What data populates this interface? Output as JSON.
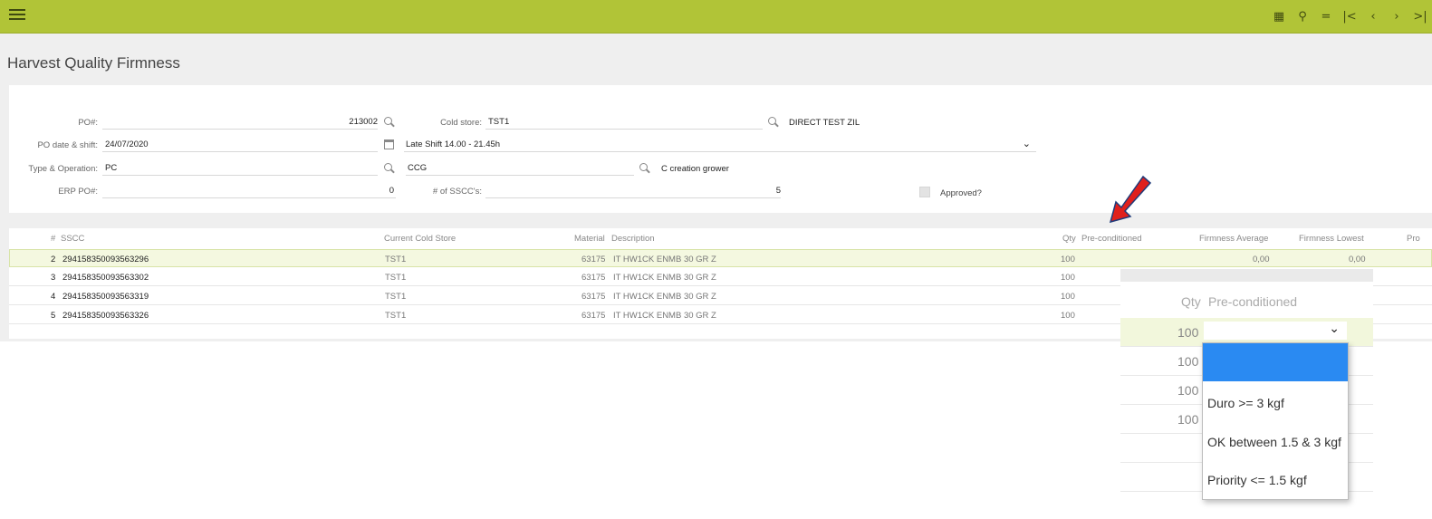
{
  "toolbar": {
    "menu_icon": "hamburger-menu-icon",
    "icons": [
      "calendar-icon",
      "search-icon",
      "minus-icon",
      "first-page-icon",
      "previous-icon",
      "next-icon",
      "last-page-icon"
    ],
    "glyphs": [
      "▦",
      "⚲",
      "=",
      "|<",
      "‹",
      "›",
      ">|"
    ],
    "accent_color": "#b1c437"
  },
  "page": {
    "title": "Harvest Quality Firmness"
  },
  "form": {
    "po_label": "PO#:",
    "po_value": "213002",
    "cold_store_label": "Cold store:",
    "cold_store_value": "TST1",
    "cold_store_desc": "DIRECT TEST ZIL",
    "po_date_label": "PO date & shift:",
    "po_date_value": "24/07/2020",
    "shift_value": "Late Shift 14.00 - 21.45h",
    "type_op_label": "Type & Operation:",
    "type_value": "PC",
    "operation_value": "CCG",
    "operation_desc": "C creation grower",
    "erp_po_label": "ERP PO#:",
    "erp_po_value": "0",
    "sscc_count_label": "# of SSCC's:",
    "sscc_count_value": "5",
    "approved_label": "Approved?"
  },
  "grid": {
    "headers": {
      "num": "#",
      "sscc": "SSCC",
      "cold_store": "Current Cold Store",
      "material": "Material",
      "description": "Description",
      "qty": "Qty",
      "preconditioned": "Pre-conditioned",
      "firm_avg": "Firmness Average",
      "firm_low": "Firmness Lowest",
      "pro": "Pro"
    },
    "rows": [
      {
        "num": "2",
        "sscc": "294158350093563296",
        "cold_store": "TST1",
        "material": "63175",
        "description": "IT HW1CK ENMB 30 GR Z",
        "qty": "100",
        "firm_avg": "0,00",
        "firm_low": "0,00"
      },
      {
        "num": "3",
        "sscc": "294158350093563302",
        "cold_store": "TST1",
        "material": "63175",
        "description": "IT HW1CK ENMB 30 GR Z",
        "qty": "100",
        "firm_avg": "",
        "firm_low": ""
      },
      {
        "num": "4",
        "sscc": "294158350093563319",
        "cold_store": "TST1",
        "material": "63175",
        "description": "IT HW1CK ENMB 30 GR Z",
        "qty": "100",
        "firm_avg": "",
        "firm_low": ""
      },
      {
        "num": "5",
        "sscc": "294158350093563326",
        "cold_store": "TST1",
        "material": "63175",
        "description": "IT HW1CK ENMB 30 GR Z",
        "qty": "100",
        "firm_avg": "",
        "firm_low": ""
      }
    ]
  },
  "zoom": {
    "qty_header": "Qty",
    "pre_header": "Pre-conditioned",
    "qty_values": [
      "100",
      "100",
      "100",
      "100"
    ]
  },
  "dropdown": {
    "options": [
      "",
      "Duro >= 3 kgf",
      "OK between 1.5 & 3 kgf",
      "Priority <= 1.5 kgf"
    ],
    "highlight_color": "#2a8af2"
  }
}
